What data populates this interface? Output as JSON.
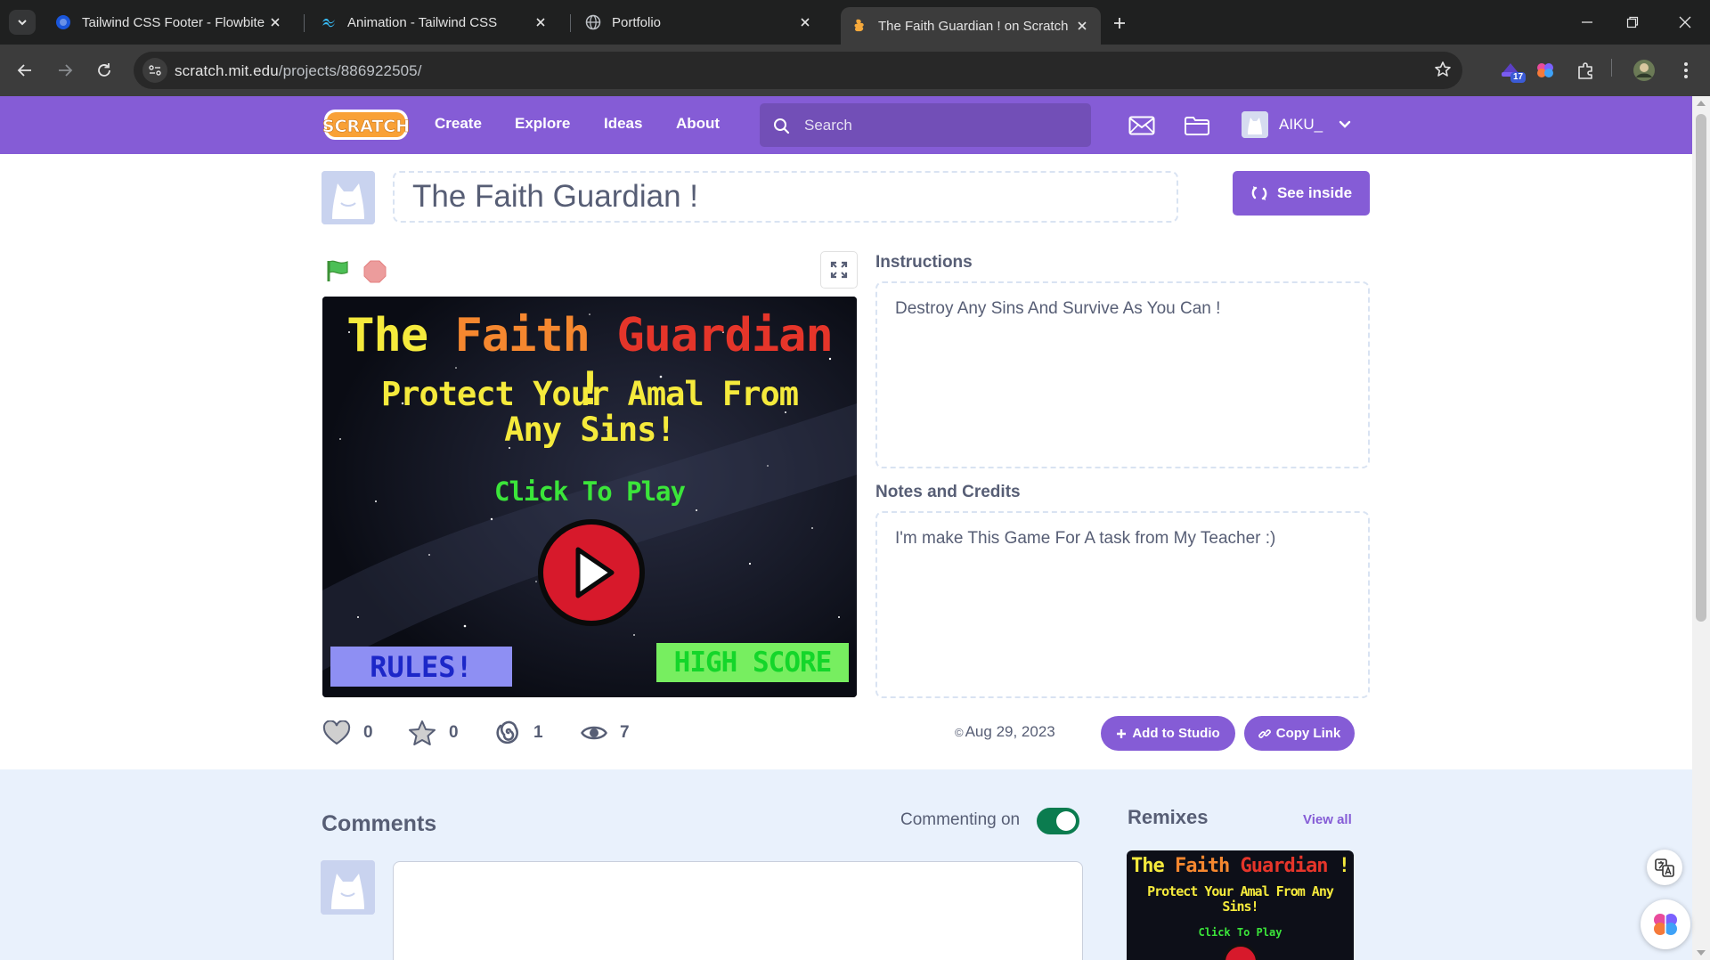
{
  "browser": {
    "tabs": [
      {
        "title": "Tailwind CSS Footer - Flowbite",
        "icon": "flowbite-icon"
      },
      {
        "title": "Animation - Tailwind CSS",
        "icon": "tailwind-icon"
      },
      {
        "title": "Portfolio",
        "icon": "globe-icon"
      },
      {
        "title": "The Faith Guardian ! on Scratch",
        "icon": "scratch-icon",
        "active": true
      }
    ],
    "url_host": "scratch.mit.edu",
    "url_path": "/projects/886922505/",
    "extension_badge": "17"
  },
  "scratch_nav": {
    "logo_text": "SCRATCH",
    "links": [
      "Create",
      "Explore",
      "Ideas",
      "About"
    ],
    "search_placeholder": "Search",
    "username": "AIKU_"
  },
  "project": {
    "title": "The Faith Guardian !",
    "see_inside_label": "See inside",
    "instructions_label": "Instructions",
    "instructions": "Destroy Any Sins And Survive As You Can !",
    "notes_label": "Notes and Credits",
    "notes": "I'm make This Game For A task from My Teacher :)",
    "stats": {
      "loves": "0",
      "favorites": "0",
      "remixes": "1",
      "views": "7"
    },
    "date": "Aug 29, 2023",
    "add_to_studio_label": "Add to Studio",
    "copy_link_label": "Copy Link"
  },
  "stage": {
    "title_words": [
      "The",
      "Faith",
      "Guardian",
      "!"
    ],
    "subtitle": "Protect Your Amal From Any Sins!",
    "click_to_play": "Click To Play",
    "rules_label": "RULES!",
    "high_score_label": "HIGH SCORE"
  },
  "comments": {
    "title": "Comments",
    "commenting_label": "Commenting on",
    "commenting_enabled": true
  },
  "remixes": {
    "title": "Remixes",
    "view_all_label": "View all"
  },
  "colors": {
    "scratch_purple": "#855cd6",
    "page_blue": "#e9f1fc",
    "toggle_green": "#0b7c4f"
  }
}
